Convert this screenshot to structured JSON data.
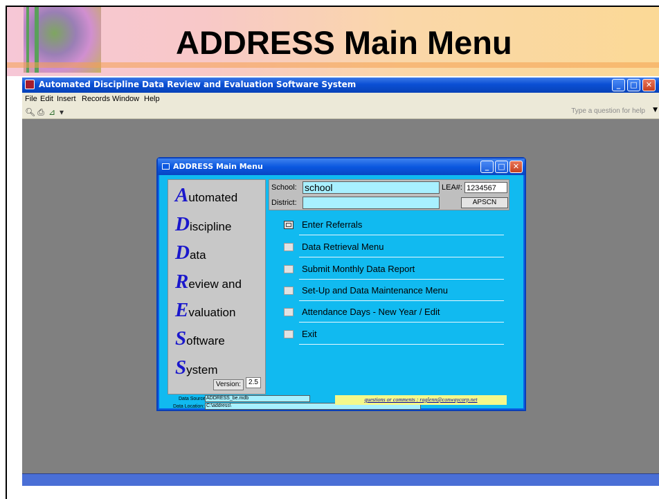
{
  "slide": {
    "title": "ADDRESS Main Menu"
  },
  "app": {
    "title": "Automated  Discipline Data Review and Evaluation Software System",
    "menu": [
      "File",
      "Edit",
      "Insert",
      "Records",
      "Window",
      "Help"
    ],
    "help_placeholder": "Type a question for help",
    "toolbar_icons": [
      "print-preview-icon",
      "print-icon",
      "chart-icon",
      "dropdown-arrow-icon"
    ]
  },
  "form": {
    "title": "ADDRESS Main Menu",
    "acronym": [
      {
        "initial": "A",
        "rest": "utomated"
      },
      {
        "initial": "D",
        "rest": "iscipline"
      },
      {
        "initial": "D",
        "rest": "ata"
      },
      {
        "initial": "R",
        "rest": "eview and"
      },
      {
        "initial": "E",
        "rest": "valuation"
      },
      {
        "initial": "S",
        "rest": "oftware"
      },
      {
        "initial": "S",
        "rest": "ystem"
      }
    ],
    "school_label": "School:",
    "school_value": "school",
    "lea_label": "LEA#:",
    "lea_value": "1234567",
    "district_label": "District:",
    "district_value": "",
    "apscn_label": "APSCN",
    "menu_items": [
      "Enter Referrals",
      "Data Retrieval Menu",
      "Submit Monthly Data Report",
      "Set-Up and Data Maintenance Menu",
      "Attendance Days - New Year / Edit",
      "Exit"
    ],
    "version_label": "Version:",
    "version_value": "2.5",
    "data_source_label": "Data Source:",
    "data_source_value": "ADDRESS_be.mdb",
    "data_location_label": "Data Location:",
    "data_location_value": "C:\\address\\",
    "contact": "questions or comments : raglenn@conwaycorp.net"
  }
}
